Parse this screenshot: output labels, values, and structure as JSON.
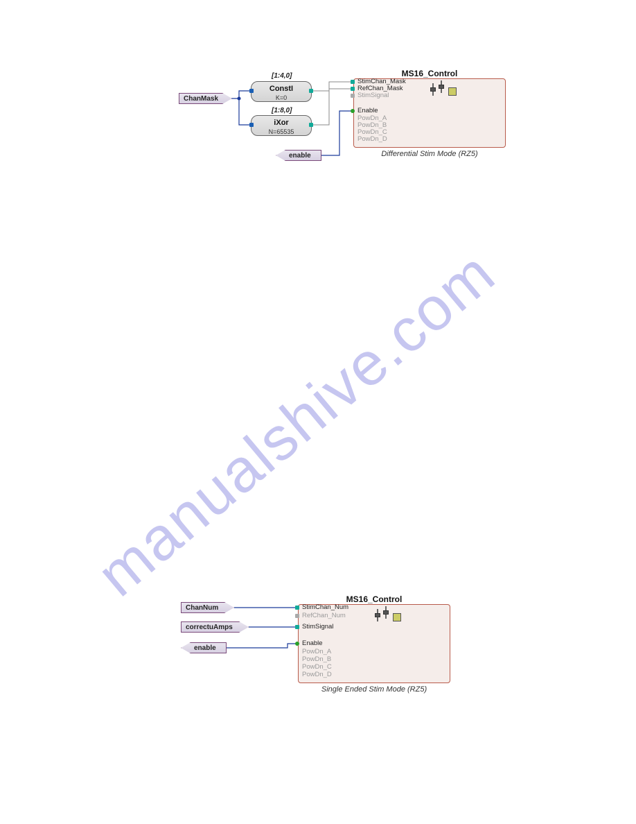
{
  "diagram1": {
    "tags": {
      "chanmask": "ChanMask",
      "enable": "enable"
    },
    "blocks": {
      "consti": {
        "range": "[1:4,0]",
        "title": "ConstI",
        "sub": "K=0"
      },
      "ixor": {
        "range": "[1:8,0]",
        "title": "iXor",
        "sub": "N=65535"
      }
    },
    "ms16": {
      "title": "MS16_Control",
      "caption": "Differential Stim Mode (RZ5)",
      "ports_active": [
        "StimChan_Mask",
        "RefChan_Mask",
        "Enable"
      ],
      "ports_grey": [
        "StimSignal",
        "PowDn_A",
        "PowDn_B",
        "PowDn_C",
        "PowDn_D"
      ]
    }
  },
  "diagram2": {
    "tags": {
      "channum": "ChanNum",
      "correctua": "correctuAmps",
      "enable": "enable"
    },
    "ms16": {
      "title": "MS16_Control",
      "caption": "Single Ended Stim Mode (RZ5)",
      "ports_active": [
        "StimChan_Num",
        "StimSignal",
        "Enable"
      ],
      "ports_grey": [
        "RefChan_Num",
        "PowDn_A",
        "PowDn_B",
        "PowDn_C",
        "PowDn_D"
      ]
    }
  },
  "watermark": "manualshive.com"
}
